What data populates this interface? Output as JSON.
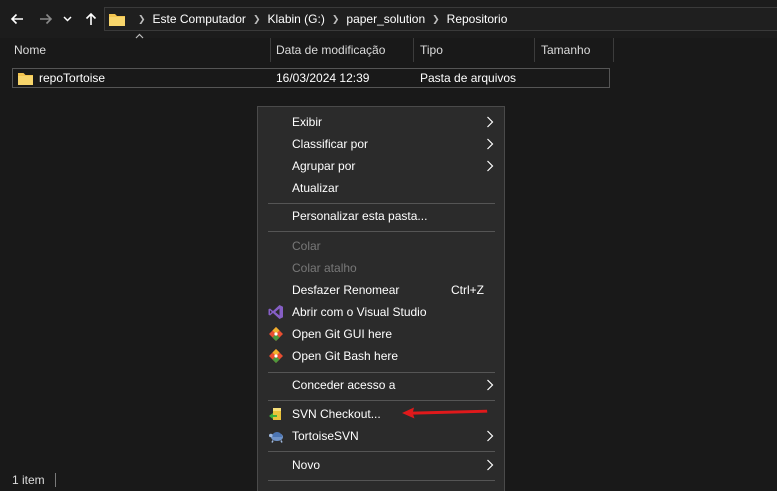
{
  "nav": {
    "back_icon": "arrow-left-icon",
    "forward_icon": "arrow-right-icon",
    "recent_icon": "chevron-down-icon",
    "up_icon": "arrow-up-icon",
    "breadcrumb": [
      "Este Computador",
      "Klabin (G:)",
      "paper_solution",
      "Repositorio"
    ]
  },
  "columns": {
    "name": "Nome",
    "modified": "Data de modificação",
    "type": "Tipo",
    "size": "Tamanho"
  },
  "files": [
    {
      "name": "repoTortoise",
      "modified": "16/03/2024 12:39",
      "type": "Pasta de arquivos",
      "size": ""
    }
  ],
  "status": {
    "count": "1 item"
  },
  "context_menu": {
    "items": [
      {
        "label": "Exibir",
        "submenu": true
      },
      {
        "label": "Classificar por",
        "submenu": true
      },
      {
        "label": "Agrupar por",
        "submenu": true
      },
      {
        "label": "Atualizar"
      },
      {
        "label": "Personalizar esta pasta..."
      },
      {
        "label": "Colar",
        "disabled": true
      },
      {
        "label": "Colar atalho",
        "disabled": true
      },
      {
        "label": "Desfazer Renomear",
        "shortcut": "Ctrl+Z"
      },
      {
        "label": "Abrir com o Visual Studio",
        "icon": "visual-studio-icon"
      },
      {
        "label": "Open Git GUI here",
        "icon": "git-gui-icon"
      },
      {
        "label": "Open Git Bash here",
        "icon": "git-bash-icon"
      },
      {
        "label": "Conceder acesso a",
        "submenu": true
      },
      {
        "label": "SVN Checkout...",
        "icon": "svn-checkout-icon"
      },
      {
        "label": "TortoiseSVN",
        "icon": "tortoisesvn-icon",
        "submenu": true
      },
      {
        "label": "Novo",
        "submenu": true
      }
    ]
  },
  "colors": {
    "background": "#191919",
    "menu_background": "#2b2b2b",
    "annotation_arrow": "#e0191b",
    "folder": "#f2c44f"
  }
}
